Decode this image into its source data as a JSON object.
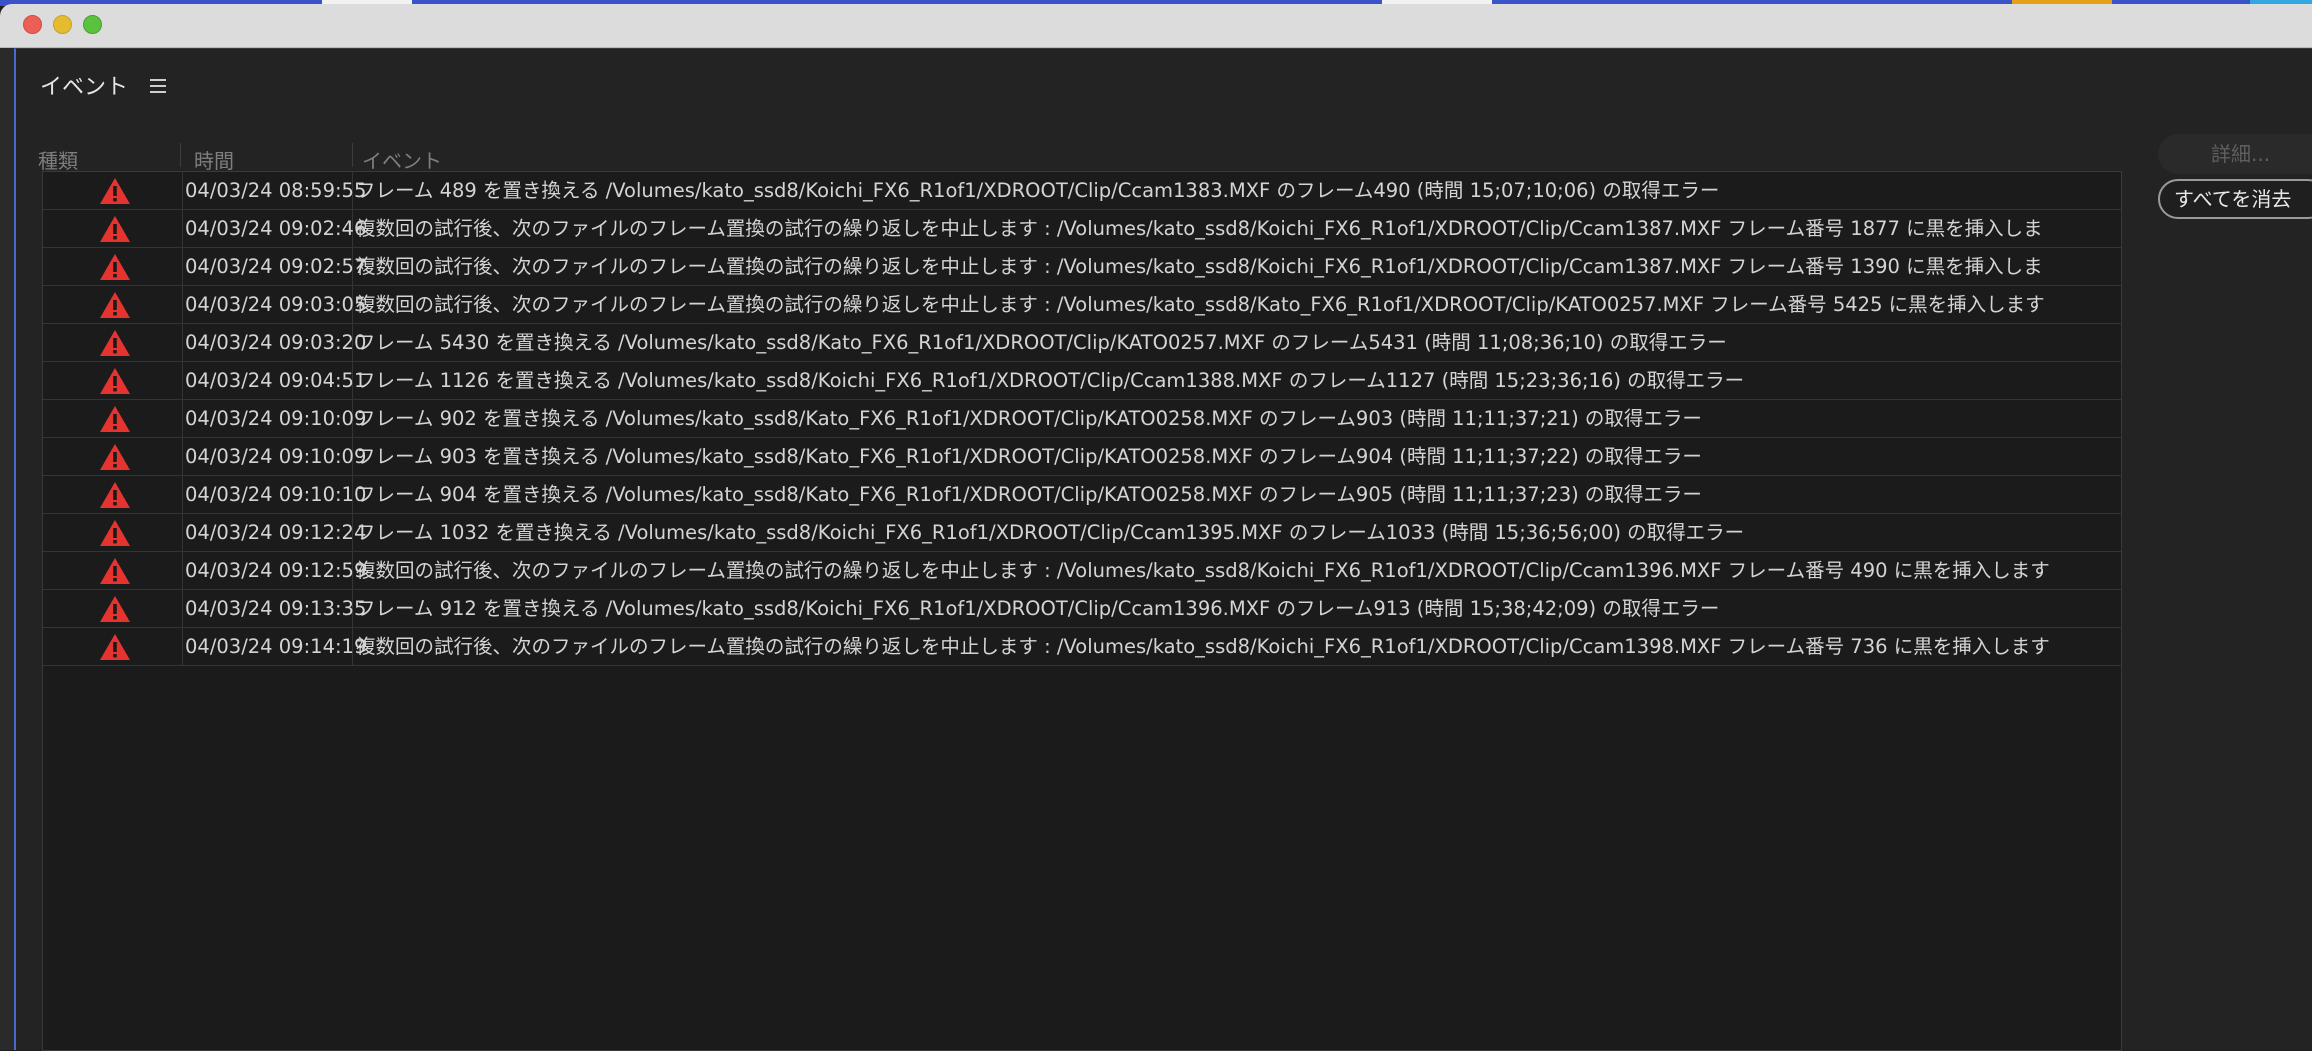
{
  "window": {
    "panel_title": "イベント"
  },
  "table": {
    "headers": {
      "type": "種類",
      "time": "時間",
      "event": "イベント"
    },
    "rows": [
      {
        "type": "warning-icon",
        "time": "04/03/24 08:59:55",
        "event": "フレーム 489 を置き換える /Volumes/kato_ssd8/Koichi_FX6_R1of1/XDROOT/Clip/Ccam1383.MXF のフレーム490 (時間 15;07;10;06) の取得エラー"
      },
      {
        "type": "warning-icon",
        "time": "04/03/24 09:02:46",
        "event": "複数回の試行後、次のファイルのフレーム置換の試行の繰り返しを中止します : /Volumes/kato_ssd8/Koichi_FX6_R1of1/XDROOT/Clip/Ccam1387.MXF  フレーム番号 1877 に黒を挿入しま"
      },
      {
        "type": "warning-icon",
        "time": "04/03/24 09:02:57",
        "event": "複数回の試行後、次のファイルのフレーム置換の試行の繰り返しを中止します : /Volumes/kato_ssd8/Koichi_FX6_R1of1/XDROOT/Clip/Ccam1387.MXF  フレーム番号 1390 に黒を挿入しま"
      },
      {
        "type": "warning-icon",
        "time": "04/03/24 09:03:05",
        "event": "複数回の試行後、次のファイルのフレーム置換の試行の繰り返しを中止します : /Volumes/kato_ssd8/Kato_FX6_R1of1/XDROOT/Clip/KATO0257.MXF  フレーム番号 5425 に黒を挿入します"
      },
      {
        "type": "warning-icon",
        "time": "04/03/24 09:03:20",
        "event": "フレーム 5430 を置き換える /Volumes/kato_ssd8/Kato_FX6_R1of1/XDROOT/Clip/KATO0257.MXF のフレーム5431 (時間 11;08;36;10) の取得エラー"
      },
      {
        "type": "warning-icon",
        "time": "04/03/24 09:04:51",
        "event": "フレーム 1126 を置き換える /Volumes/kato_ssd8/Koichi_FX6_R1of1/XDROOT/Clip/Ccam1388.MXF のフレーム1127 (時間 15;23;36;16) の取得エラー"
      },
      {
        "type": "warning-icon",
        "time": "04/03/24 09:10:09",
        "event": "フレーム 902 を置き換える /Volumes/kato_ssd8/Kato_FX6_R1of1/XDROOT/Clip/KATO0258.MXF のフレーム903 (時間 11;11;37;21) の取得エラー"
      },
      {
        "type": "warning-icon",
        "time": "04/03/24 09:10:09",
        "event": "フレーム 903 を置き換える /Volumes/kato_ssd8/Kato_FX6_R1of1/XDROOT/Clip/KATO0258.MXF のフレーム904 (時間 11;11;37;22) の取得エラー"
      },
      {
        "type": "warning-icon",
        "time": "04/03/24 09:10:10",
        "event": "フレーム 904 を置き換える /Volumes/kato_ssd8/Kato_FX6_R1of1/XDROOT/Clip/KATO0258.MXF のフレーム905 (時間 11;11;37;23) の取得エラー"
      },
      {
        "type": "warning-icon",
        "time": "04/03/24 09:12:24",
        "event": "フレーム 1032 を置き換える /Volumes/kato_ssd8/Koichi_FX6_R1of1/XDROOT/Clip/Ccam1395.MXF のフレーム1033 (時間 15;36;56;00) の取得エラー"
      },
      {
        "type": "warning-icon",
        "time": "04/03/24 09:12:59",
        "event": "複数回の試行後、次のファイルのフレーム置換の試行の繰り返しを中止します : /Volumes/kato_ssd8/Koichi_FX6_R1of1/XDROOT/Clip/Ccam1396.MXF  フレーム番号 490 に黒を挿入します"
      },
      {
        "type": "warning-icon",
        "time": "04/03/24 09:13:35",
        "event": "フレーム 912 を置き換える /Volumes/kato_ssd8/Koichi_FX6_R1of1/XDROOT/Clip/Ccam1396.MXF のフレーム913 (時間 15;38;42;09) の取得エラー"
      },
      {
        "type": "warning-icon",
        "time": "04/03/24 09:14:19",
        "event": "複数回の試行後、次のファイルのフレーム置換の試行の繰り返しを中止します : /Volumes/kato_ssd8/Koichi_FX6_R1of1/XDROOT/Clip/Ccam1398.MXF  フレーム番号 736 に黒を挿入します"
      }
    ]
  },
  "buttons": {
    "details": "詳細...",
    "clear_all": "すべてを消去"
  },
  "colors": {
    "warning": "#e5342f",
    "background": "#1b1b1b",
    "text": "#d4d4d4"
  }
}
